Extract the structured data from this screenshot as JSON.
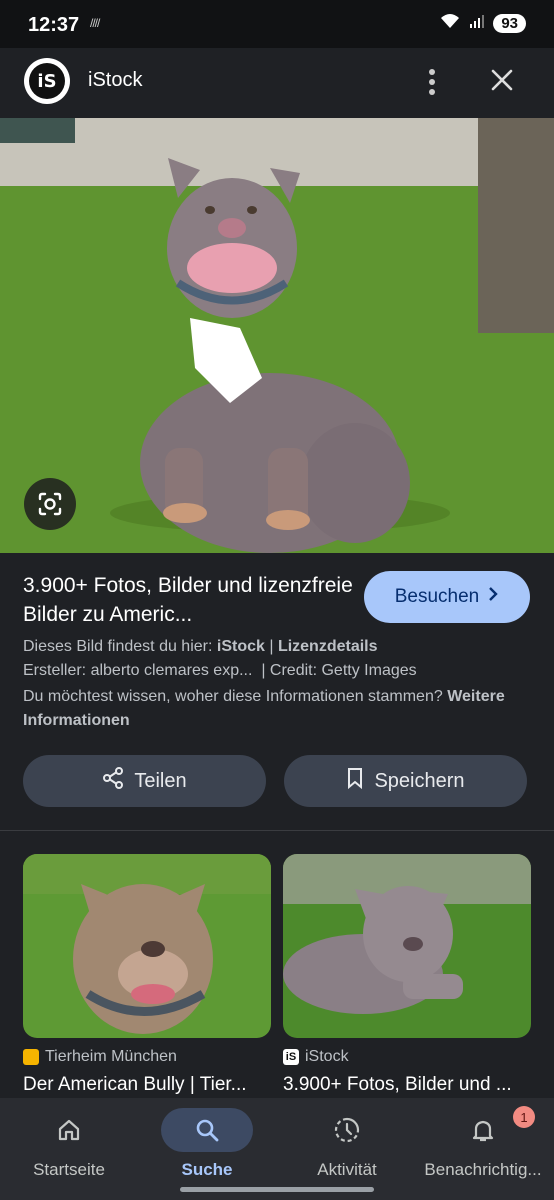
{
  "status_bar": {
    "time": "12:37",
    "extra": "////",
    "battery": "93"
  },
  "header": {
    "logo_text": "iS",
    "title": "iStock",
    "menu_icon": "more-vert-icon",
    "close_icon": "close-icon"
  },
  "hero": {
    "lens_icon": "lens-icon"
  },
  "result": {
    "title": "3.900+ Fotos, Bilder und lizenzfreie Bilder zu Americ...",
    "visit_label": "Besuchen",
    "source_prefix": "Dieses Bild findest du hier: ",
    "source_name": "iStock",
    "separator": " | ",
    "license_link": "Lizenzdetails",
    "creator": "Ersteller: alberto clemares exp...",
    "credit": "| Credit: Getty Images",
    "more_prefix": "Du möchtest wissen, woher diese Informationen stammen? ",
    "more_link": "Weitere Informationen",
    "share_label": "Teilen",
    "save_label": "Speichern"
  },
  "related": [
    {
      "source": "Tierheim München",
      "title": "Der American Bully | Tier...",
      "source_color": "#f6b400"
    },
    {
      "source": "iStock",
      "title": "3.900+ Fotos, Bilder und ...",
      "source_color": "#ffffff"
    }
  ],
  "nav": {
    "items": [
      {
        "label": "Startseite",
        "icon": "home-icon"
      },
      {
        "label": "Suche",
        "icon": "search-icon"
      },
      {
        "label": "Aktivität",
        "icon": "activity-icon"
      },
      {
        "label": "Benachrichtig...",
        "icon": "bell-icon"
      }
    ],
    "badge": "1"
  },
  "colors": {
    "accent": "#a8c7fa",
    "background": "#1f2125",
    "pill": "#3c4350"
  }
}
